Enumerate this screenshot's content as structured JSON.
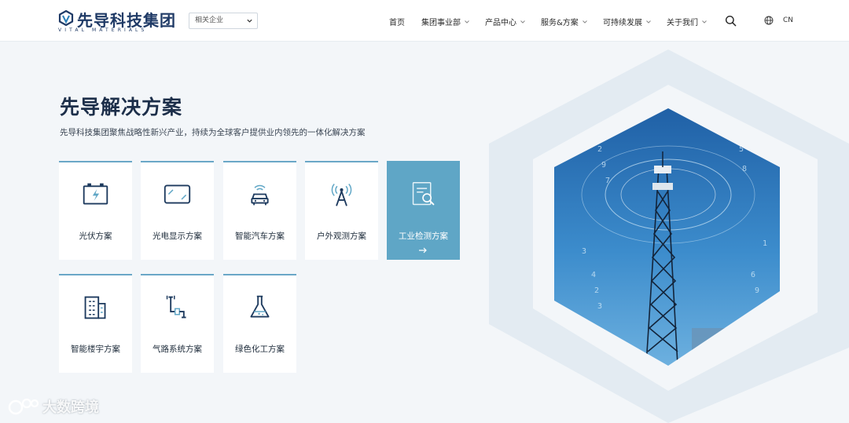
{
  "header": {
    "logo_text": "先导科技集团",
    "logo_sub_prefix": "VITAL",
    "logo_sub": "VITAL MATERIALS",
    "company_select": "相关企业",
    "nav": [
      {
        "label": "首页",
        "has_caret": false
      },
      {
        "label": "集团事业部",
        "has_caret": true
      },
      {
        "label": "产品中心",
        "has_caret": true
      },
      {
        "label": "服务&方案",
        "has_caret": true
      },
      {
        "label": "可持续发展",
        "has_caret": true
      },
      {
        "label": "关于我们",
        "has_caret": true
      }
    ],
    "lang": "CN"
  },
  "main": {
    "title": "先导解决方案",
    "subtitle": "先导科技集团聚焦战略性新兴产业，持续为全球客户提供业内领先的一体化解决方案",
    "cards": [
      {
        "label": "光伏方案",
        "icon": "battery-icon"
      },
      {
        "label": "光电显示方案",
        "icon": "display-icon"
      },
      {
        "label": "智能汽车方案",
        "icon": "car-icon"
      },
      {
        "label": "户外观测方案",
        "icon": "antenna-icon"
      },
      {
        "label": "工业检测方案",
        "icon": "inspect-icon",
        "active": true
      },
      {
        "label": "智能楼宇方案",
        "icon": "building-icon"
      },
      {
        "label": "气路系统方案",
        "icon": "pipe-icon"
      },
      {
        "label": "绿色化工方案",
        "icon": "flask-icon"
      }
    ]
  },
  "watermark": "大数跨境",
  "colors": {
    "brand": "#1f3a66",
    "accent": "#5fa6c6",
    "card_top": "#6aa7c7",
    "background": "#f3f6f9"
  }
}
